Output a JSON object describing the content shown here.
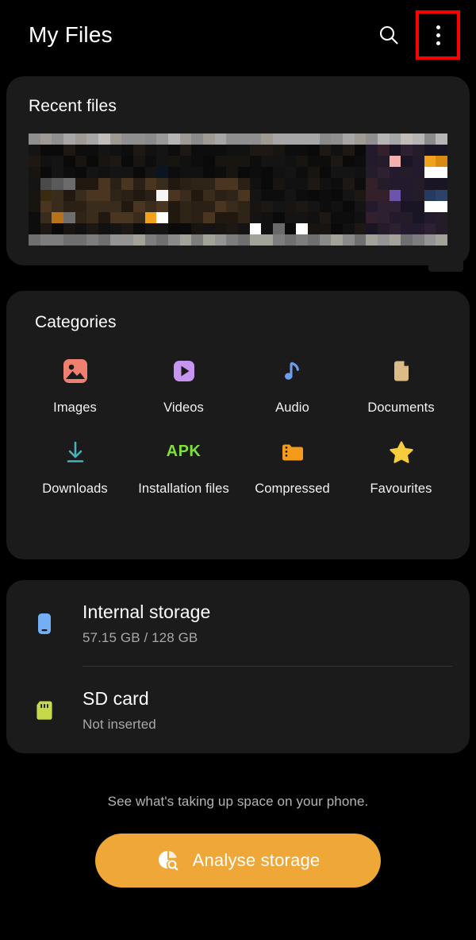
{
  "header": {
    "title": "My Files",
    "search_icon": "search-icon",
    "more_icon": "more-vertical-icon"
  },
  "recent": {
    "title": "Recent files"
  },
  "categories": {
    "title": "Categories",
    "items": [
      {
        "label": "Images",
        "icon": "image-icon",
        "color": "#ef7f6e"
      },
      {
        "label": "Videos",
        "icon": "video-play-icon",
        "color": "#c695f0"
      },
      {
        "label": "Audio",
        "icon": "music-note-icon",
        "color": "#6f9ded"
      },
      {
        "label": "Documents",
        "icon": "document-icon",
        "color": "#ddbb86"
      },
      {
        "label": "Downloads",
        "icon": "download-icon",
        "color": "#4ab0b8"
      },
      {
        "label": "Installation\nfiles",
        "icon": "apk-icon",
        "color": "#7ee03c",
        "text": "APK"
      },
      {
        "label": "Compressed",
        "icon": "folder-zip-icon",
        "color": "#f59b1c"
      },
      {
        "label": "Favourites",
        "icon": "star-icon",
        "color": "#f6cd3c"
      }
    ]
  },
  "storage": {
    "rows": [
      {
        "name": "Internal storage",
        "sub": "57.15 GB / 128 GB",
        "icon": "phone-icon",
        "color": "#74aef5"
      },
      {
        "name": "SD card",
        "sub": "Not inserted",
        "icon": "sd-card-icon",
        "color": "#c5d94a"
      }
    ]
  },
  "footer": {
    "note": "See what's taking up space on your phone.",
    "button_label": "Analyse storage",
    "button_icon": "pie-chart-search-icon",
    "button_color": "#efa838"
  },
  "highlight": {
    "target": "more-vertical-icon",
    "color": "#ff0000"
  },
  "thumbnail_mosaic": {
    "description": "Pixelated recent-file thumbnail strip",
    "palette": [
      "#0d0d0d",
      "#1a1a1a",
      "#2b2620",
      "#3a3025",
      "#8a8a8a",
      "#a8a8a8",
      "#c0c0c0",
      "#f2a11c",
      "#ffffff",
      "#f3b0ac",
      "#b0b4e0",
      "#6a54b0",
      "#253a5e",
      "#5c3a1c"
    ]
  }
}
